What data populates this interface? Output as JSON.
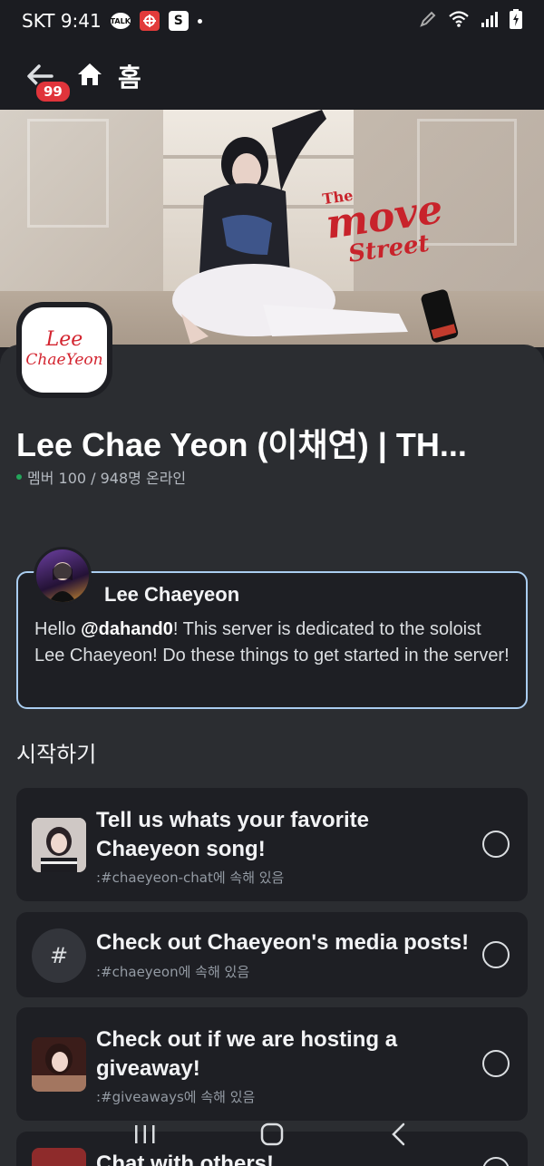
{
  "status_bar": {
    "carrier_time": "SKT 9:41",
    "talk_icon_label": "TALK",
    "s_icon_label": "S"
  },
  "header": {
    "badge_count": "99",
    "title": "홈"
  },
  "banner": {
    "title_line1": "The",
    "title_line2": "move",
    "title_line3": "Street"
  },
  "server": {
    "logo_line1": "Lee",
    "logo_line2": "ChaeYeon",
    "name": "Lee Chae Yeon (이채연) | TH...",
    "members": "멤버 100 / 948명 온라인"
  },
  "welcome": {
    "author": "Lee Chaeyeon",
    "text_before": "Hello ",
    "mention": "@dahand0",
    "text_after": "! This server is dedicated to the soloist Lee Chaeyeon! Do these things to get started in the server!"
  },
  "section_title": "시작하기",
  "tasks": [
    {
      "title": "Tell us whats your favorite Chaeyeon song!",
      "subtitle": ":#chaeyeon-chat에 속해 있음"
    },
    {
      "title": "Check out Chaeyeon's media posts!",
      "subtitle": ":#chaeyeon에 속해 있음",
      "icon_glyph": "#"
    },
    {
      "title": "Check out if we are hosting a giveaway!",
      "subtitle": ":#giveaways에 속해 있음"
    },
    {
      "title": "Chat with others!"
    }
  ],
  "colors": {
    "background": "#1e1f24",
    "sheet": "#2b2d31",
    "card_border": "#aacdf0",
    "badge": "#e0343b",
    "online": "#23a55a"
  }
}
